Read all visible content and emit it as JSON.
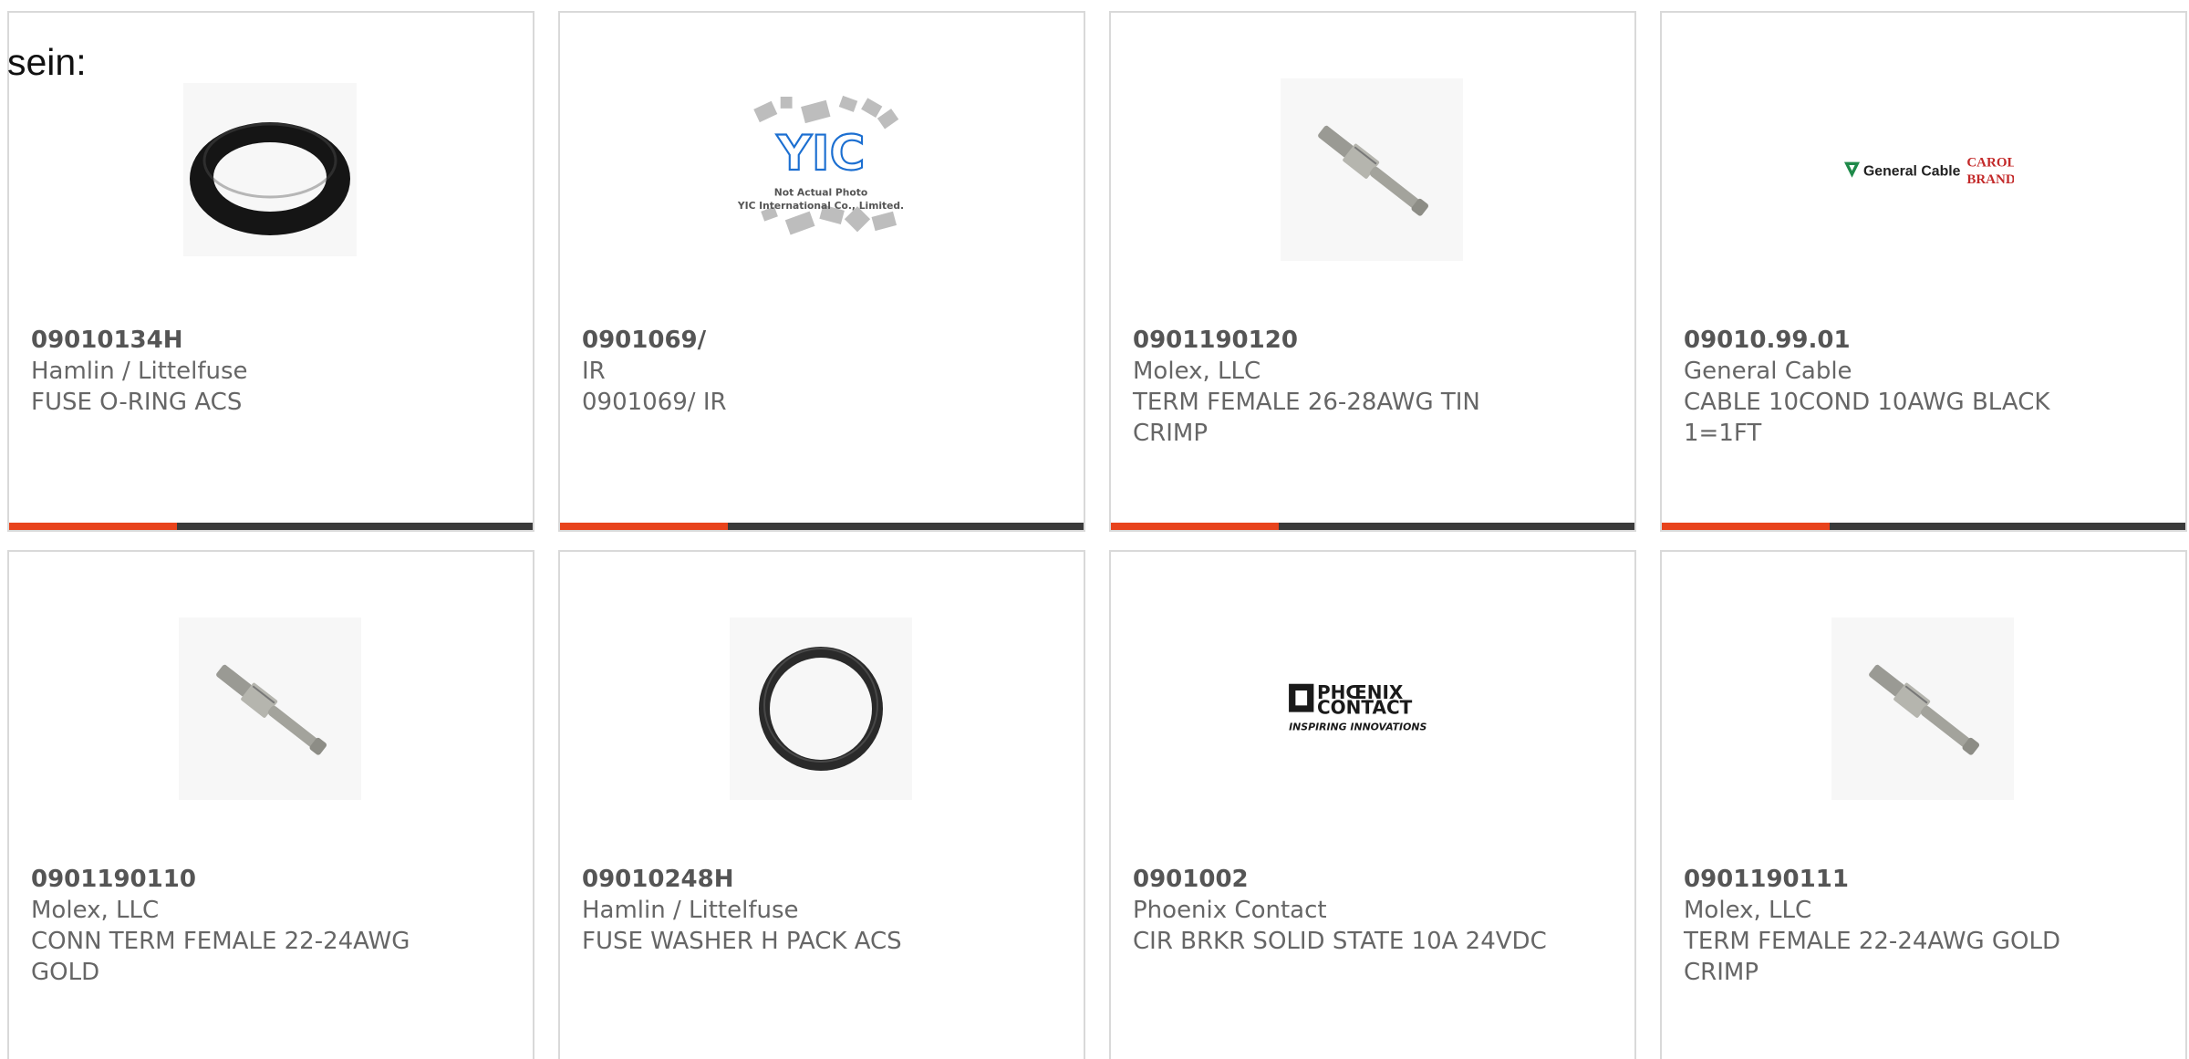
{
  "intro_text": "sein:",
  "colors": {
    "accent": "#e8431c",
    "track": "#3a3a3a",
    "card_border": "#d9d9d9",
    "text": "#666666"
  },
  "products": [
    {
      "part_number": "09010134H",
      "manufacturer": "Hamlin / Littelfuse",
      "description": "FUSE O-RING ACS",
      "image_icon": "o-ring-icon",
      "progress": 0.32
    },
    {
      "part_number": "0901069/",
      "manufacturer": "IR",
      "description": "0901069/ IR",
      "image_icon": "yic-not-actual-photo-icon",
      "image_logo_text": "YIC",
      "image_caption_1": "Not Actual Photo",
      "image_caption_2": "YIC International Co., Limited.",
      "progress": 0.32
    },
    {
      "part_number": "0901190120",
      "manufacturer": "Molex, LLC",
      "description": "TERM FEMALE 26-28AWG TIN CRIMP",
      "image_icon": "crimp-terminal-icon",
      "progress": 0.32
    },
    {
      "part_number": "09010.99.01",
      "manufacturer": "General Cable",
      "description": "CABLE 10COND 10AWG BLACK 1=1FT",
      "image_icon": "general-cable-logo-icon",
      "image_logo_text": "General Cable",
      "image_logo_text_2": "CAROL BRAND",
      "progress": 0.32
    },
    {
      "part_number": "0901190110",
      "manufacturer": "Molex, LLC",
      "description": "CONN TERM FEMALE 22-24AWG GOLD",
      "image_icon": "crimp-terminal-icon",
      "progress": null
    },
    {
      "part_number": "09010248H",
      "manufacturer": "Hamlin / Littelfuse",
      "description": "FUSE WASHER H PACK ACS",
      "image_icon": "washer-icon",
      "progress": null
    },
    {
      "part_number": "0901002",
      "manufacturer": "Phoenix Contact",
      "description": "CIR BRKR SOLID STATE 10A 24VDC",
      "image_icon": "phoenix-contact-logo-icon",
      "image_logo_text": "PHŒNIX CONTACT",
      "image_logo_text_2": "INSPIRING INNOVATIONS",
      "progress": null
    },
    {
      "part_number": "0901190111",
      "manufacturer": "Molex, LLC",
      "description": "TERM FEMALE 22-24AWG GOLD CRIMP",
      "image_icon": "crimp-terminal-icon",
      "progress": null
    }
  ]
}
